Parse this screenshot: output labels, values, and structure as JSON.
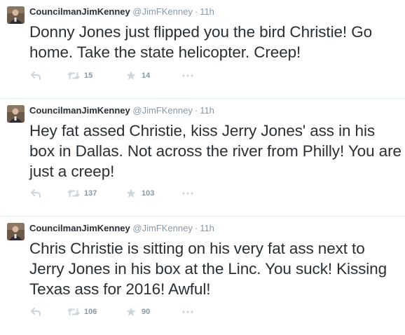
{
  "tweets": [
    {
      "name": "CouncilmanJimKenney",
      "handle": "@JimFKenney",
      "separator": "·",
      "time": "11h",
      "text": "Donny Jones just flipped you the bird Christie! Go home. Take the state helicopter. Creep!",
      "retweets": "15",
      "favorites": "14"
    },
    {
      "name": "CouncilmanJimKenney",
      "handle": "@JimFKenney",
      "separator": "·",
      "time": "11h",
      "text": "Hey fat assed Christie, kiss Jerry Jones' ass in his box in Dallas. Not across the river from Philly! You are just a creep!",
      "retweets": "137",
      "favorites": "103"
    },
    {
      "name": "CouncilmanJimKenney",
      "handle": "@JimFKenney",
      "separator": "·",
      "time": "11h",
      "text": "Chris Christie is sitting on his very fat ass next to Jerry Jones in his box at the Linc. You suck! Kissing Texas ass for 2016! Awful!",
      "retweets": "106",
      "favorites": "90"
    }
  ],
  "icons": {
    "reply": "reply-icon",
    "retweet": "retweet-icon",
    "favorite": "star-icon",
    "more": "more-dots-icon"
  },
  "colors": {
    "text": "#292f33",
    "muted": "#8899a6",
    "divider": "#e1e8ed",
    "icon": "#ccd6dd"
  }
}
